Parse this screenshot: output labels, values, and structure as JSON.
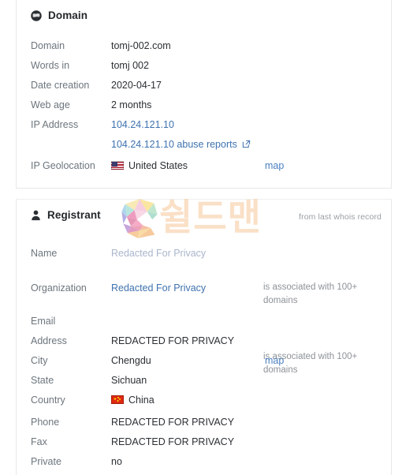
{
  "domain_card": {
    "icon": "globe-icon",
    "title": "Domain",
    "rows": [
      {
        "label": "Domain",
        "value": "tomj-002.com",
        "style": "plain"
      },
      {
        "label": "Words in",
        "value": "tomj 002",
        "style": "plain"
      },
      {
        "label": "Date creation",
        "value": "2020-04-17",
        "style": "plain"
      },
      {
        "label": "Web age",
        "value": "2 months",
        "style": "plain"
      },
      {
        "label": "IP Address",
        "value": "104.24.121.10",
        "style": "link"
      },
      {
        "label": "",
        "value": "104.24.121.10 abuse reports",
        "style": "link-external",
        "icon": "external-link-icon"
      },
      {
        "label": "IP Geolocation",
        "value": "United States",
        "style": "flag",
        "flag": "us-flag-icon",
        "side_link": "map"
      }
    ]
  },
  "registrant_card": {
    "icon": "user-icon",
    "title": "Registrant",
    "note": "from last whois record",
    "rows": [
      {
        "label": "Name",
        "value": "Redacted For Privacy",
        "style": "link-faded",
        "side_note": "is associated with 100+ domains"
      },
      {
        "label": "Organization",
        "value": "Redacted For Privacy",
        "style": "link",
        "side_note": "is associated with 100+ domains"
      },
      {
        "label": "Email",
        "value": "",
        "style": "plain"
      },
      {
        "label": "Address",
        "value": "REDACTED FOR PRIVACY",
        "style": "plain"
      },
      {
        "label": "City",
        "value": "Chengdu",
        "style": "plain",
        "side_link": "map"
      },
      {
        "label": "State",
        "value": "Sichuan",
        "style": "plain"
      },
      {
        "label": "Country",
        "value": "China",
        "style": "flag",
        "flag": "cn-flag-icon"
      },
      {
        "label": "Phone",
        "value": "REDACTED FOR PRIVACY",
        "style": "plain"
      },
      {
        "label": "Fax",
        "value": "REDACTED FOR PRIVACY",
        "style": "plain"
      },
      {
        "label": "Private",
        "value": "no",
        "style": "plain"
      }
    ]
  },
  "watermark": {
    "logo_mark": "s-logo-icon",
    "text": "쉴드맨"
  },
  "colors": {
    "link": "#3f72af",
    "label": "#6c757d",
    "value": "#2b2f33",
    "muted": "#8d9298",
    "faded_link": "#a9b5cc",
    "card_border": "#e8e8e8"
  }
}
